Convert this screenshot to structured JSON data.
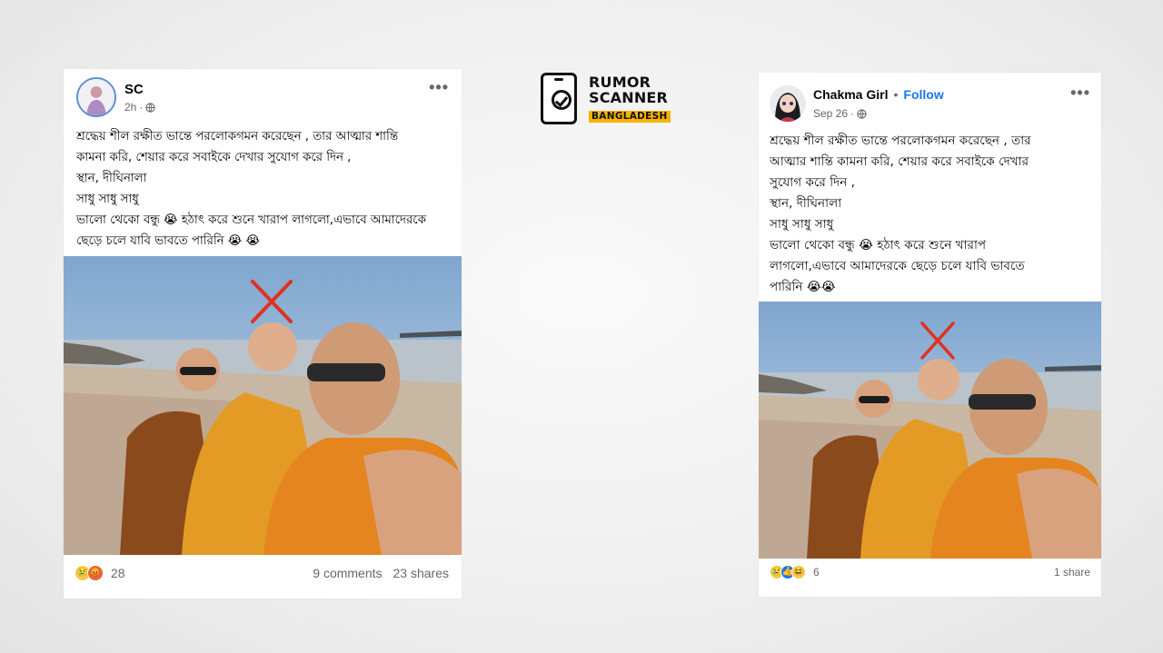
{
  "logo": {
    "line1": "RUMOR",
    "line2": "SCANNER",
    "line3": "BANGLADESH",
    "accent_color": "#f5b300"
  },
  "left_post": {
    "author": "SC",
    "time": "2h",
    "meta_sep": "·",
    "text_lines": [
      "শ্রদ্ধেয় শীল রক্ষীত ভান্তে  পরলোকগমন করেছেন , তার আত্মার শান্তি",
      "কামনা করি, শেয়ার করে সবাইকে দেখার সুযোগ করে দিন ,",
      "স্থান, দীঘিনালা",
      "সাধু সাধু সাধু",
      "ভালো থেকো বন্ধু 😭  হঠাৎ করে শুনে খারাপ লাগলো,এভাবে আমাদেরকে",
      "ছেড়ে চলে যাবি ভাবতে পারিনি 😭 😭"
    ],
    "reaction_icons": [
      "sad-react-icon",
      "angry-react-icon"
    ],
    "reaction_count": "28",
    "comments": "9 comments",
    "shares": "23 shares",
    "more": "•••"
  },
  "right_post": {
    "author": "Chakma Girl",
    "follow_sep": "•",
    "follow": "Follow",
    "time": "Sep 26",
    "meta_sep": "·",
    "text_lines": [
      "শ্রদ্ধেয় শীল রক্ষীত ভান্তে  পরলোকগমন করেছেন , তার",
      "আত্মার শান্তি কামনা করি, শেয়ার করে সবাইকে দেখার",
      "সুযোগ করে দিন ,",
      "স্থান, দীঘিনালা",
      "সাধু সাধু সাধু",
      "ভালো থেকো বন্ধু 😭  হঠাৎ করে শুনে খারাপ",
      "লাগলো,এভাবে আমাদেরকে ছেড়ে চলে যাবি ভাবতে",
      "পারিনি 😭😭"
    ],
    "reaction_icons": [
      "sad-react-icon",
      "like-react-icon",
      "haha-react-icon"
    ],
    "reaction_count": "6",
    "shares": "1 share",
    "more": "•••"
  },
  "colors": {
    "facebook_blue": "#1877f2",
    "robe_orange": "#e08a1e",
    "robe_dark": "#8a4a1c",
    "mark_red": "#e0311f"
  }
}
